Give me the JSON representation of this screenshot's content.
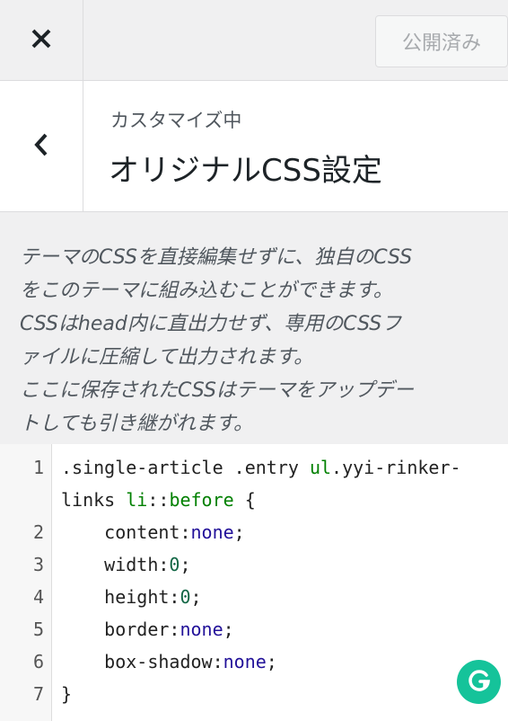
{
  "topbar": {
    "close_icon": "close-icon",
    "publish_label": "公開済み"
  },
  "header": {
    "back_icon": "chevron-left-icon",
    "customizing_label": "カスタマイズ中",
    "section_title": "オリジナルCSS設定"
  },
  "description": "テーマのCSSを直接編集せずに、独自のCSS\nをこのテーマに組み込むことができます。\nCSSはhead内に直出力せず、専用のCSSフ\nァイルに圧縮して出力されます。\nここに保存されたCSSはテーマをアップデー\nトしても引き継がれます。",
  "editor": {
    "line_numbers": [
      "1",
      "2",
      "3",
      "4",
      "5",
      "6",
      "7"
    ],
    "lines": [
      [
        ".single-article .entry ",
        "ul",
        ".yyi-rinker-"
      ],
      [
        "links ",
        "li",
        "::",
        "before",
        " {"
      ],
      [
        "    content:",
        "none",
        ";"
      ],
      [
        "    width:",
        "0",
        ";"
      ],
      [
        "    height:",
        "0",
        ";"
      ],
      [
        "    border:",
        "none",
        ";"
      ],
      [
        "    box-shadow:",
        "none",
        ";"
      ],
      [
        "}"
      ]
    ]
  },
  "grammarly": {
    "icon": "grammarly-icon",
    "color": "#15c39a"
  },
  "colors": {
    "keyword": "#008000",
    "value": "#221199",
    "number": "#116644",
    "background": "#f0f0f1"
  }
}
